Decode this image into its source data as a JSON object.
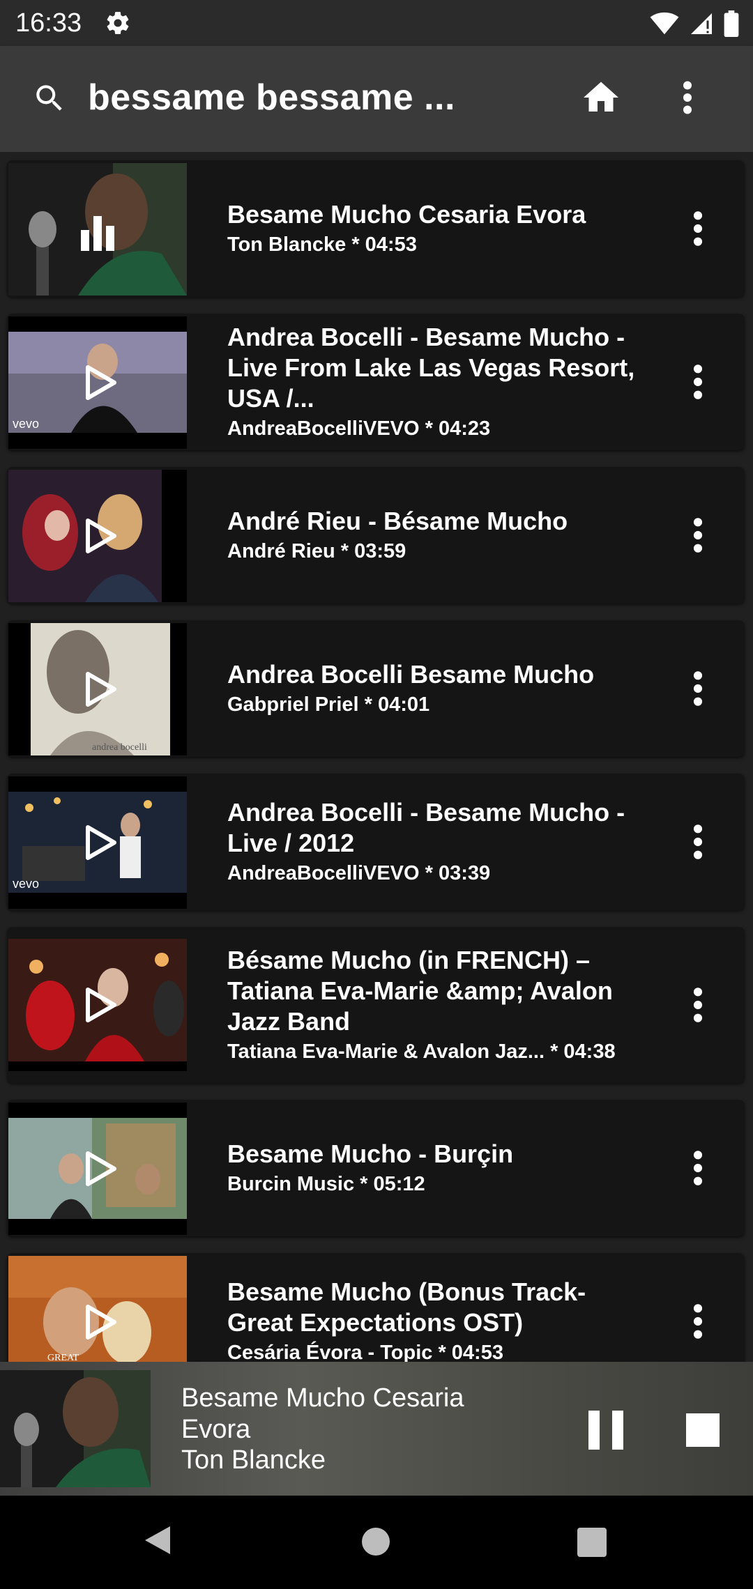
{
  "status_bar": {
    "time": "16:33"
  },
  "toolbar": {
    "search_query": "bessame bessame ..."
  },
  "results": [
    {
      "title": "Besame Mucho Cesaria Evora",
      "subtitle": "Ton Blancke * 04:53",
      "playing": true
    },
    {
      "title": "Andrea Bocelli - Besame Mucho - Live From Lake Las Vegas Resort, USA /...",
      "subtitle": "AndreaBocelliVEVO * 04:23",
      "playing": false
    },
    {
      "title": "André Rieu - Bésame Mucho",
      "subtitle": "André Rieu * 03:59",
      "playing": false
    },
    {
      "title": "Andrea Bocelli Besame Mucho",
      "subtitle": "Gabpriel Priel * 04:01",
      "playing": false
    },
    {
      "title": "Andrea Bocelli - Besame Mucho - Live / 2012",
      "subtitle": "AndreaBocelliVEVO * 03:39",
      "playing": false
    },
    {
      "title": "Bésame Mucho (in FRENCH) – Tatiana Eva-Marie &amp; Avalon Jazz Band",
      "subtitle": "Tatiana Eva-Marie & Avalon Jaz... * 04:38",
      "playing": false
    },
    {
      "title": "Besame Mucho - Burçin",
      "subtitle": "Burcin Music * 05:12",
      "playing": false
    },
    {
      "title": "Besame Mucho (Bonus Track-Great Expectations OST)",
      "subtitle": "Cesária Évora - Topic * 04:53",
      "playing": false
    }
  ],
  "mini_player": {
    "title": "Besame Mucho Cesaria Evora",
    "artist": "Ton Blancke"
  },
  "thumb_labels": {
    "vevo": "vevo",
    "andrea": "andrea bocelli",
    "great": "GREAT"
  },
  "colors": {
    "background": "#202020",
    "card": "#151515",
    "toolbar": "#3a3a3a",
    "text": "#ffffff"
  }
}
